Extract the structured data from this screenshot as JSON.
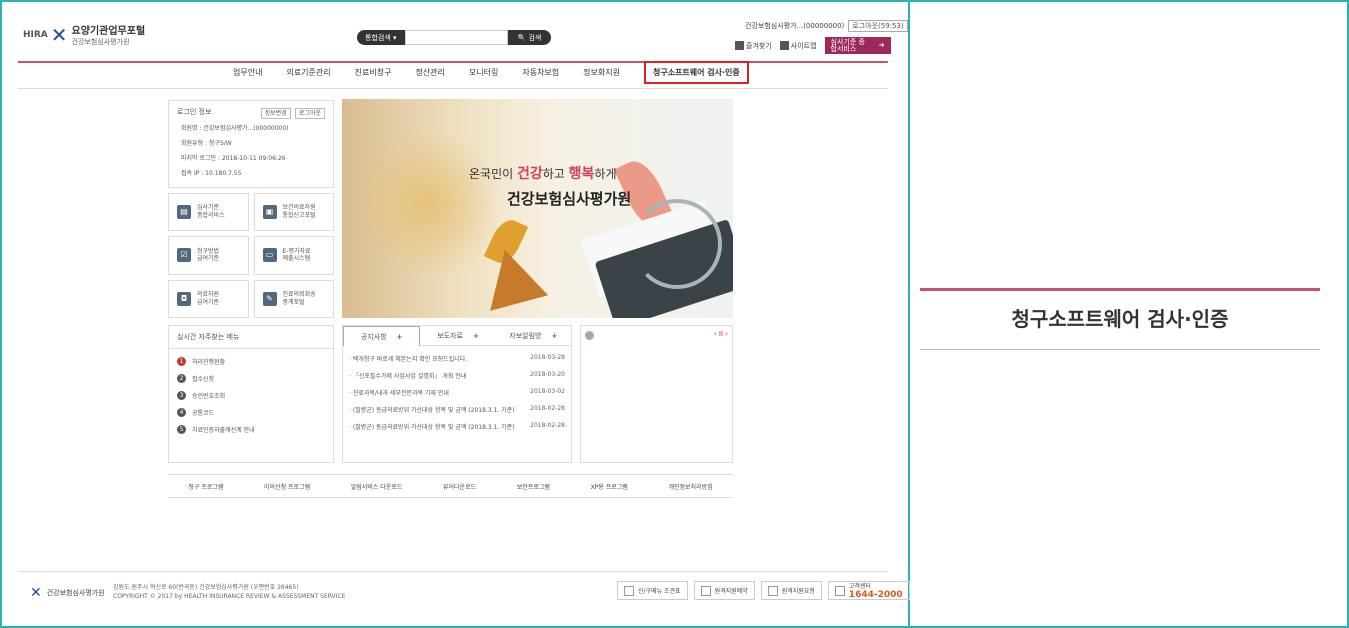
{
  "header": {
    "logo_hira": "HIRA",
    "logo_title": "요양기관업무포털",
    "logo_subtitle": "건강보험심사평가원",
    "search_scope": "통합검색",
    "search_button": "검색",
    "user_name": "건강보험심사평가...(00000000)",
    "logout_timer": "로그아웃(59:53)",
    "util_fav": "즐겨찾기",
    "util_sitemap": "사이트맵",
    "special_service": "심사기준 종합서비스"
  },
  "nav": {
    "items": [
      "업무안내",
      "의료기준관리",
      "진료비청구",
      "정산관리",
      "모니터링",
      "자동차보험",
      "정보화지원"
    ],
    "highlighted": "청구소프트웨어 검사·인증"
  },
  "login_box": {
    "title": "로그인 정보",
    "btn_mypage": "정보변경",
    "btn_logout": "로그아웃",
    "rows": [
      "회원명 : 건강보험심사평가...(00000000)",
      "회원유형 : 청구S/W",
      "마지막 로그인 : 2018-10-11 09:06:26",
      "접속 IP : 10.180.7.55"
    ]
  },
  "quick": [
    {
      "l1": "심사기준",
      "l2": "종합서비스"
    },
    {
      "l1": "보건의료자원",
      "l2": "통합신고포털"
    },
    {
      "l1": "청구방법",
      "l2": "급여기준"
    },
    {
      "l1": "E-평가자료",
      "l2": "제출시스템"
    },
    {
      "l1": "의료자원",
      "l2": "급여기준"
    },
    {
      "l1": "진료의뢰회송",
      "l2": "중계포털"
    }
  ],
  "banner": {
    "line1_pre": "온국민이 ",
    "line1_b1": "건강",
    "line1_mid": "하고 ",
    "line1_b2": "행복",
    "line1_post": "하게",
    "line2": "건강보험심사평가원"
  },
  "freq": {
    "title": "실시간 자주찾는 메뉴",
    "items": [
      "처리진행현황",
      "접수신청",
      "승인번호조회",
      "공통코드",
      "치료인증자출캐선계 안내"
    ]
  },
  "notices": {
    "tabs": [
      "공지사항",
      "보도자료",
      "자보알림방"
    ],
    "rows": [
      {
        "t": "· 택개청구 바로게 해본는지 확인 요청드립니다.",
        "d": "2018-03-28"
      },
      {
        "t": "· 「신포필수가제 사업사업 설명회」 개최 안내",
        "d": "2018-03-20"
      },
      {
        "t": "· 진료과목/내과 세부전문과목 기재 안내",
        "d": "2018-03-02"
      },
      {
        "t": "· (질병군) 동급의료방위 가산대상 항목 및 금액 (2018.3.1. 기준)",
        "d": "2018-02-28"
      },
      {
        "t": "· (질병군) 동급의료방위 가산대상 항목 및 금액 (2018.3.1. 기준)",
        "d": "2018-02-28"
      }
    ]
  },
  "popup": {
    "pager": "‹ II ›"
  },
  "programs": [
    "청구 프로그램",
    "이의신청 프로그램",
    "알림서비스 다운로드",
    "뷰어다운로드",
    "보안프로그램",
    "XP용 프로그램",
    "개인정보처리방침"
  ],
  "footer": {
    "org": "건강보험심사평가원",
    "addr1": "강원도 원주시 혁신로 60(반곡동) 건강보험심사평가원 (우편번호 26465)",
    "addr2": "COPYRIGHT © 2017 by HEALTH INSURANCE REVIEW & ASSESSMENT SERVICE",
    "btn1": "신/구메뉴 조견표",
    "btn2": "원격지원예약",
    "btn3": "원격지원요청",
    "call_label": "고객센터",
    "call_number": "1644-2000"
  },
  "right_panel": {
    "title": "청구소프트웨어 검사·인증"
  },
  "colors": {
    "frame": "#2ab3b0",
    "accent": "#c9536e",
    "highlight": "#e02020"
  }
}
